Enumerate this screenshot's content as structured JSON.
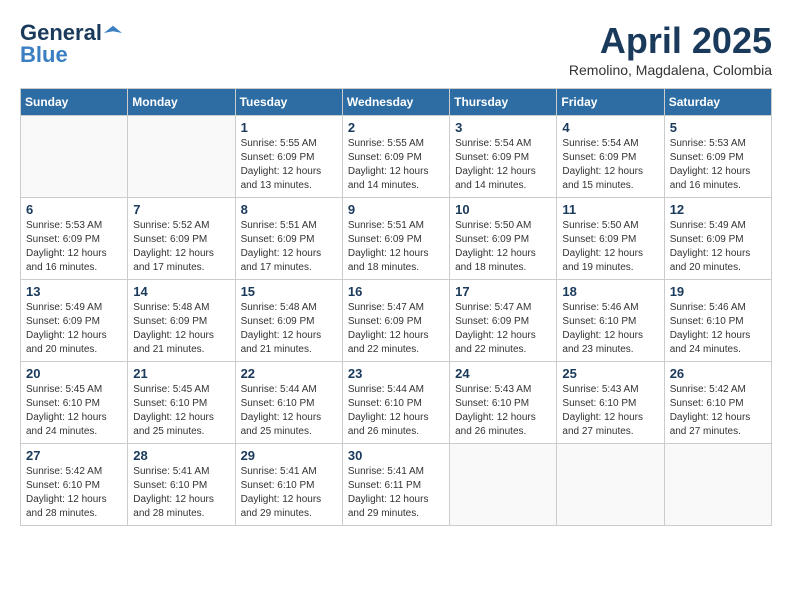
{
  "header": {
    "logo": {
      "general": "General",
      "blue": "Blue"
    },
    "title": "April 2025",
    "location": "Remolino, Magdalena, Colombia"
  },
  "weekdays": [
    "Sunday",
    "Monday",
    "Tuesday",
    "Wednesday",
    "Thursday",
    "Friday",
    "Saturday"
  ],
  "weeks": [
    [
      {
        "day": null
      },
      {
        "day": null
      },
      {
        "day": 1,
        "sunrise": "Sunrise: 5:55 AM",
        "sunset": "Sunset: 6:09 PM",
        "daylight": "Daylight: 12 hours and 13 minutes."
      },
      {
        "day": 2,
        "sunrise": "Sunrise: 5:55 AM",
        "sunset": "Sunset: 6:09 PM",
        "daylight": "Daylight: 12 hours and 14 minutes."
      },
      {
        "day": 3,
        "sunrise": "Sunrise: 5:54 AM",
        "sunset": "Sunset: 6:09 PM",
        "daylight": "Daylight: 12 hours and 14 minutes."
      },
      {
        "day": 4,
        "sunrise": "Sunrise: 5:54 AM",
        "sunset": "Sunset: 6:09 PM",
        "daylight": "Daylight: 12 hours and 15 minutes."
      },
      {
        "day": 5,
        "sunrise": "Sunrise: 5:53 AM",
        "sunset": "Sunset: 6:09 PM",
        "daylight": "Daylight: 12 hours and 16 minutes."
      }
    ],
    [
      {
        "day": 6,
        "sunrise": "Sunrise: 5:53 AM",
        "sunset": "Sunset: 6:09 PM",
        "daylight": "Daylight: 12 hours and 16 minutes."
      },
      {
        "day": 7,
        "sunrise": "Sunrise: 5:52 AM",
        "sunset": "Sunset: 6:09 PM",
        "daylight": "Daylight: 12 hours and 17 minutes."
      },
      {
        "day": 8,
        "sunrise": "Sunrise: 5:51 AM",
        "sunset": "Sunset: 6:09 PM",
        "daylight": "Daylight: 12 hours and 17 minutes."
      },
      {
        "day": 9,
        "sunrise": "Sunrise: 5:51 AM",
        "sunset": "Sunset: 6:09 PM",
        "daylight": "Daylight: 12 hours and 18 minutes."
      },
      {
        "day": 10,
        "sunrise": "Sunrise: 5:50 AM",
        "sunset": "Sunset: 6:09 PM",
        "daylight": "Daylight: 12 hours and 18 minutes."
      },
      {
        "day": 11,
        "sunrise": "Sunrise: 5:50 AM",
        "sunset": "Sunset: 6:09 PM",
        "daylight": "Daylight: 12 hours and 19 minutes."
      },
      {
        "day": 12,
        "sunrise": "Sunrise: 5:49 AM",
        "sunset": "Sunset: 6:09 PM",
        "daylight": "Daylight: 12 hours and 20 minutes."
      }
    ],
    [
      {
        "day": 13,
        "sunrise": "Sunrise: 5:49 AM",
        "sunset": "Sunset: 6:09 PM",
        "daylight": "Daylight: 12 hours and 20 minutes."
      },
      {
        "day": 14,
        "sunrise": "Sunrise: 5:48 AM",
        "sunset": "Sunset: 6:09 PM",
        "daylight": "Daylight: 12 hours and 21 minutes."
      },
      {
        "day": 15,
        "sunrise": "Sunrise: 5:48 AM",
        "sunset": "Sunset: 6:09 PM",
        "daylight": "Daylight: 12 hours and 21 minutes."
      },
      {
        "day": 16,
        "sunrise": "Sunrise: 5:47 AM",
        "sunset": "Sunset: 6:09 PM",
        "daylight": "Daylight: 12 hours and 22 minutes."
      },
      {
        "day": 17,
        "sunrise": "Sunrise: 5:47 AM",
        "sunset": "Sunset: 6:09 PM",
        "daylight": "Daylight: 12 hours and 22 minutes."
      },
      {
        "day": 18,
        "sunrise": "Sunrise: 5:46 AM",
        "sunset": "Sunset: 6:10 PM",
        "daylight": "Daylight: 12 hours and 23 minutes."
      },
      {
        "day": 19,
        "sunrise": "Sunrise: 5:46 AM",
        "sunset": "Sunset: 6:10 PM",
        "daylight": "Daylight: 12 hours and 24 minutes."
      }
    ],
    [
      {
        "day": 20,
        "sunrise": "Sunrise: 5:45 AM",
        "sunset": "Sunset: 6:10 PM",
        "daylight": "Daylight: 12 hours and 24 minutes."
      },
      {
        "day": 21,
        "sunrise": "Sunrise: 5:45 AM",
        "sunset": "Sunset: 6:10 PM",
        "daylight": "Daylight: 12 hours and 25 minutes."
      },
      {
        "day": 22,
        "sunrise": "Sunrise: 5:44 AM",
        "sunset": "Sunset: 6:10 PM",
        "daylight": "Daylight: 12 hours and 25 minutes."
      },
      {
        "day": 23,
        "sunrise": "Sunrise: 5:44 AM",
        "sunset": "Sunset: 6:10 PM",
        "daylight": "Daylight: 12 hours and 26 minutes."
      },
      {
        "day": 24,
        "sunrise": "Sunrise: 5:43 AM",
        "sunset": "Sunset: 6:10 PM",
        "daylight": "Daylight: 12 hours and 26 minutes."
      },
      {
        "day": 25,
        "sunrise": "Sunrise: 5:43 AM",
        "sunset": "Sunset: 6:10 PM",
        "daylight": "Daylight: 12 hours and 27 minutes."
      },
      {
        "day": 26,
        "sunrise": "Sunrise: 5:42 AM",
        "sunset": "Sunset: 6:10 PM",
        "daylight": "Daylight: 12 hours and 27 minutes."
      }
    ],
    [
      {
        "day": 27,
        "sunrise": "Sunrise: 5:42 AM",
        "sunset": "Sunset: 6:10 PM",
        "daylight": "Daylight: 12 hours and 28 minutes."
      },
      {
        "day": 28,
        "sunrise": "Sunrise: 5:41 AM",
        "sunset": "Sunset: 6:10 PM",
        "daylight": "Daylight: 12 hours and 28 minutes."
      },
      {
        "day": 29,
        "sunrise": "Sunrise: 5:41 AM",
        "sunset": "Sunset: 6:10 PM",
        "daylight": "Daylight: 12 hours and 29 minutes."
      },
      {
        "day": 30,
        "sunrise": "Sunrise: 5:41 AM",
        "sunset": "Sunset: 6:11 PM",
        "daylight": "Daylight: 12 hours and 29 minutes."
      },
      {
        "day": null
      },
      {
        "day": null
      },
      {
        "day": null
      }
    ]
  ]
}
